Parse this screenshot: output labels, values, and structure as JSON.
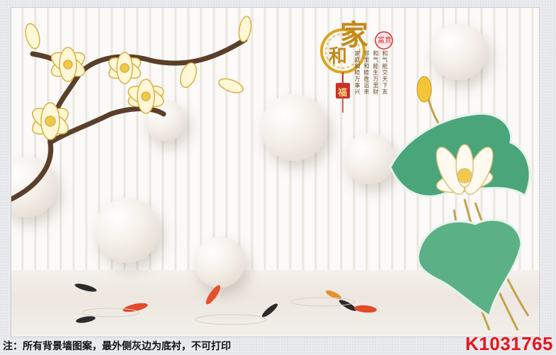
{
  "calligraphy": {
    "main_glyph_1": "家",
    "main_glyph_2": "和",
    "seal": "富贵",
    "fu": "福"
  },
  "poem": {
    "lines": [
      "和气能交天下友",
      "和气能生万里财",
      "邻里和睦胜远亲",
      "家庭和睦万事兴"
    ]
  },
  "footer": {
    "note": "注：所有背景墙图案，最外侧灰边为底衬，不可打印",
    "code": "K1031765"
  },
  "colors": {
    "accent_red": "#e8141e",
    "gold": "#d9a520",
    "leaf_green": "#3f9a73"
  }
}
